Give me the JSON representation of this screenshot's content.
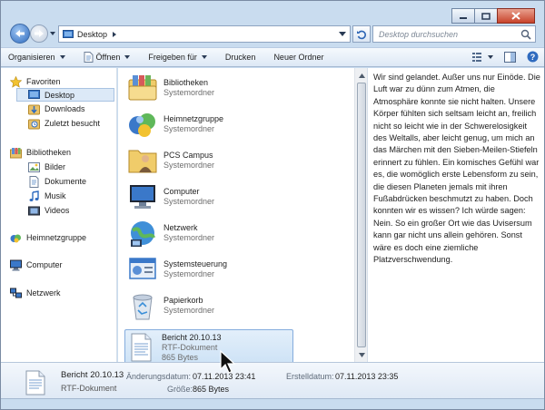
{
  "window": {
    "caption_buttons": [
      "minimize",
      "maximize",
      "close"
    ]
  },
  "address_bar": {
    "location": "Desktop",
    "search_placeholder": "Desktop durchsuchen"
  },
  "toolbar": {
    "organize": "Organisieren",
    "open": "Öffnen",
    "share": "Freigeben für",
    "print": "Drucken",
    "new_folder": "Neuer Ordner"
  },
  "nav": {
    "favorites": "Favoriten",
    "fav_items": [
      "Desktop",
      "Downloads",
      "Zuletzt besucht"
    ],
    "libraries": "Bibliotheken",
    "lib_items": [
      "Bilder",
      "Dokumente",
      "Musik",
      "Videos"
    ],
    "homegroup": "Heimnetzgruppe",
    "computer": "Computer",
    "network": "Netzwerk"
  },
  "files": [
    {
      "name": "Bibliotheken",
      "type": "Systemordner",
      "icon": "libraries-icon"
    },
    {
      "name": "Heimnetzgruppe",
      "type": "Systemordner",
      "icon": "homegroup-icon"
    },
    {
      "name": "PCS Campus",
      "type": "Systemordner",
      "icon": "user-folder-icon"
    },
    {
      "name": "Computer",
      "type": "Systemordner",
      "icon": "computer-icon"
    },
    {
      "name": "Netzwerk",
      "type": "Systemordner",
      "icon": "network-icon"
    },
    {
      "name": "Systemsteuerung",
      "type": "Systemordner",
      "icon": "control-panel-icon"
    },
    {
      "name": "Papierkorb",
      "type": "Systemordner",
      "icon": "recycle-bin-icon"
    },
    {
      "name": "Bericht 20.10.13",
      "type": "RTF-Dokument",
      "size": "865 Bytes",
      "icon": "rtf-document-icon",
      "selected": true
    }
  ],
  "preview": {
    "text": "Wir sind gelandet. Außer uns nur Einöde. Die Luft war zu dünn zum Atmen, die Atmosphäre konnte sie nicht halten. Unsere Körper fühlten sich seltsam leicht an, freilich nicht so leicht wie in der Schwerelosigkeit des Weltalls, aber leicht genug, um mich an das Märchen mit den Sieben-Meilen-Stiefeln erinnert zu fühlen. Ein komisches Gefühl war es, die womöglich erste Lebensform zu sein, die diesen Planeten jemals mit ihren Fußabdrücken beschmutzt zu haben. Doch konnten wir es wissen? Ich würde sagen: Nein. So ein großer Ort wie das Uvisersum kann gar nicht uns allein gehören. Sonst wäre es doch eine ziemliche Platzverschwendung."
  },
  "details": {
    "name": "Bericht 20.10.13",
    "type": "RTF-Dokument",
    "modified_label": "Änderungsdatum:",
    "modified_value": "07.11.2013 23:41",
    "created_label": "Erstelldatum:",
    "created_value": "07.11.2013 23:35",
    "size_label": "Größe:",
    "size_value": "865 Bytes"
  },
  "colors": {
    "chrome": "#c9dcef",
    "selection": "#cde2f6",
    "selection_border": "#84acdd"
  }
}
